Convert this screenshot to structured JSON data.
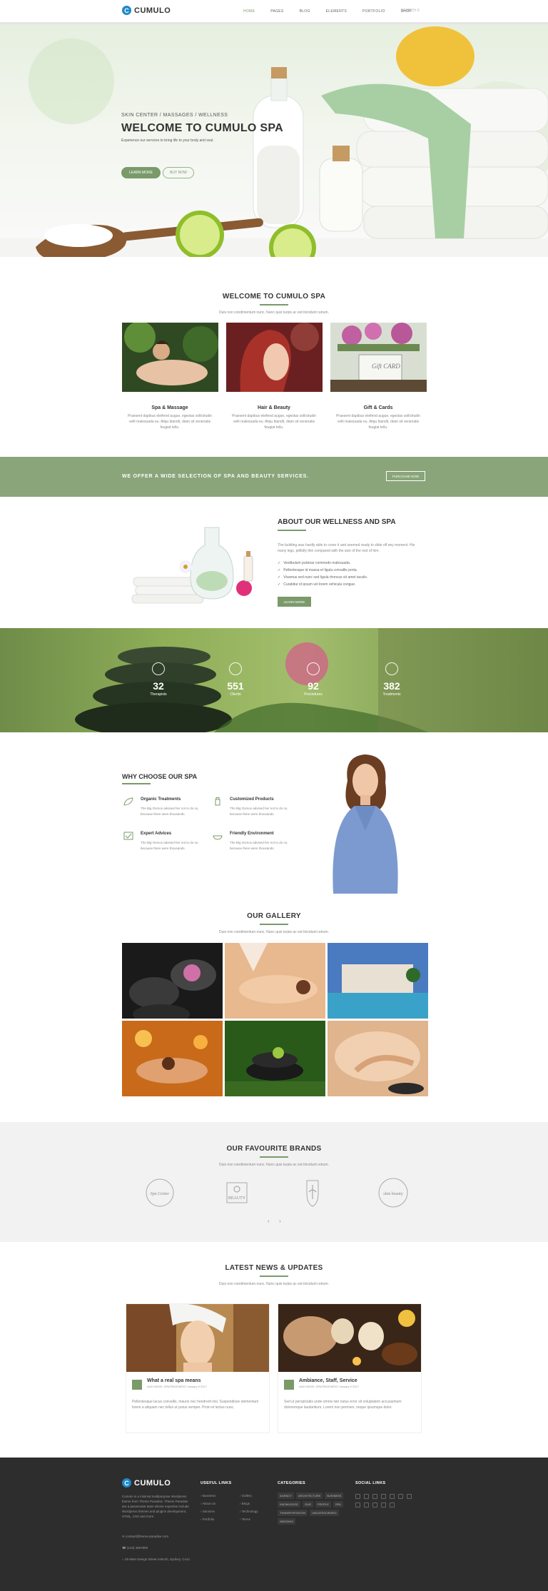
{
  "header": {
    "logo_letter": "C",
    "logo_text": "CUMULO",
    "nav": [
      "HOME",
      "PAGES",
      "BLOG",
      "ELEMENTS",
      "PORTFOLIO",
      "SHOP"
    ],
    "search_placeholder": "SEARCH"
  },
  "hero": {
    "subtitle": "SKIN CENTER / MASSAGES / WELLNESS",
    "title": "WELCOME TO CUMULO SPA",
    "description": "Experience our services to bring life to your body and soul.",
    "btn_primary": "LEARN MORE",
    "btn_secondary": "BUY NOW"
  },
  "welcome": {
    "title": "WELCOME TO CUMULO SPA",
    "subtitle": "Duis non condimentum nunc. Nunc quis turpis ac est tincidunt rutrum.",
    "services": [
      {
        "title": "Spa & Massage",
        "text": "Praesent dapibus eleifend augue, egestas sollicitudin velit malesuada eu. Aliqu blandit, diam sit venenatis feugiat tellu."
      },
      {
        "title": "Hair & Beauty",
        "text": "Praesent dapibus eleifend augue, egestas sollicitudin velit malesuada eu. Aliqu blandit, diam sit venenatis feugiat tellu."
      },
      {
        "title": "Gift & Cards",
        "text": "Praesent dapibus eleifend augue, egestas sollicitudin velit malesuada eu. Aliqu blandit, diam sit venenatis feugiat tellu."
      }
    ],
    "gift_card_text": "Gift CARD"
  },
  "banner": {
    "text": "WE OFFER A WIDE SELECTION OF SPA AND BEAUTY SERVICES.",
    "button": "PURCHASE NOW"
  },
  "about": {
    "title": "ABOUT OUR WELLNESS AND SPA",
    "description": "The building was hardly able to cover it and seemed ready to slide off any moment. His many legs, pitifully thin compared with the size of the rest of him.",
    "list": [
      "Vestibulum pulvinar commodo malesuada.",
      "Pellentesque id massa et ligula convallis porta.",
      "Vivamus sed nunc sed ligula rhoncus sit amet iaculis.",
      "Curabitur id ipsum vel lorem vehicula congue."
    ],
    "button": "LEARN MORE"
  },
  "counters": [
    {
      "value": "32",
      "label": "Therapists"
    },
    {
      "value": "551",
      "label": "Clients"
    },
    {
      "value": "92",
      "label": "Procedures"
    },
    {
      "value": "382",
      "label": "Treatments"
    }
  ],
  "why": {
    "title": "WHY CHOOSE OUR SPA",
    "features": [
      {
        "title": "Organic Treatments",
        "text": "The Big Oxmox advised her not to do so, because there were thousands."
      },
      {
        "title": "Customized Products",
        "text": "The Big Oxmox advised her not to do so, because there were thousands."
      },
      {
        "title": "Expert Advices",
        "text": "The Big Oxmox advised her not to do so, because there were thousands."
      },
      {
        "title": "Friendly Environment",
        "text": "The Big Oxmox advised her not to do so, because there were thousands."
      }
    ]
  },
  "gallery": {
    "title": "OUR GALLERY",
    "subtitle": "Duis non condimentum nunc. Nunc quis turpis ac est tincidunt rutrum."
  },
  "brands": {
    "title": "OUR FAVOURITE BRANDS",
    "subtitle": "Duis non condimentum nunc. Nunc quis turpis ac est tincidunt rutrum.",
    "items": [
      "Spa Center",
      "BEAUTY",
      "",
      "skin beauty"
    ],
    "prev": "‹",
    "next": "›"
  },
  "news": {
    "title": "LATEST NEWS & UPDATES",
    "subtitle": "Duis non condimentum nunc. Nunc quis turpis ac est tincidunt rutrum.",
    "posts": [
      {
        "title": "What a real spa means",
        "meta": "ADD NEWS, SPATREATMENT    January 9 2017",
        "excerpt": "Pellentesque lacus convallis, mauris nec hendrerit nisl. Suspendisse elementum lorem a aliquam nec tellus ut purus semper. Proin et lectus nunc."
      },
      {
        "title": "Ambiance, Staff, Service",
        "meta": "ADD NEWS, SPATREATMENT    January 9 2017",
        "excerpt": "Sed ut perspiciatis unde omnis iste natus error sit voluptatem accusantium doloremque laudantium. Lorem non permien, neque ipsumque dolor."
      }
    ]
  },
  "footer": {
    "logo_letter": "C",
    "logo_text": "CUMULO",
    "about": "Cumulo is a minimal multipurpose Wordpress theme from Theme Paradise. Theme Paradise are a passionate team whose expertise include Wordpress themes and plugins development, HTML, CSS and more.",
    "email": "contact@theme-paradise.com",
    "phone": "(123) 4567890",
    "address": "26 Main Design Street Antioch, Sydney, CA11",
    "useful_links_title": "USEFUL LINKS",
    "useful_links_col1": [
      "Business",
      "About Us",
      "Services",
      "Portfolio"
    ],
    "useful_links_col2": [
      "Gallery",
      "Blogs",
      "Technology",
      "Terms"
    ],
    "categories_title": "CATEGORIES",
    "categories": [
      "AGENCY",
      "ARCHITECTURE",
      "BUSINESS",
      "KNOWLEDGE",
      "OUR",
      "PEOPLE",
      "SPA",
      "TRANSPORTATION",
      "UNCATEGORIZED",
      "WEDDING"
    ],
    "social_title": "SOCIAL LINKS"
  }
}
